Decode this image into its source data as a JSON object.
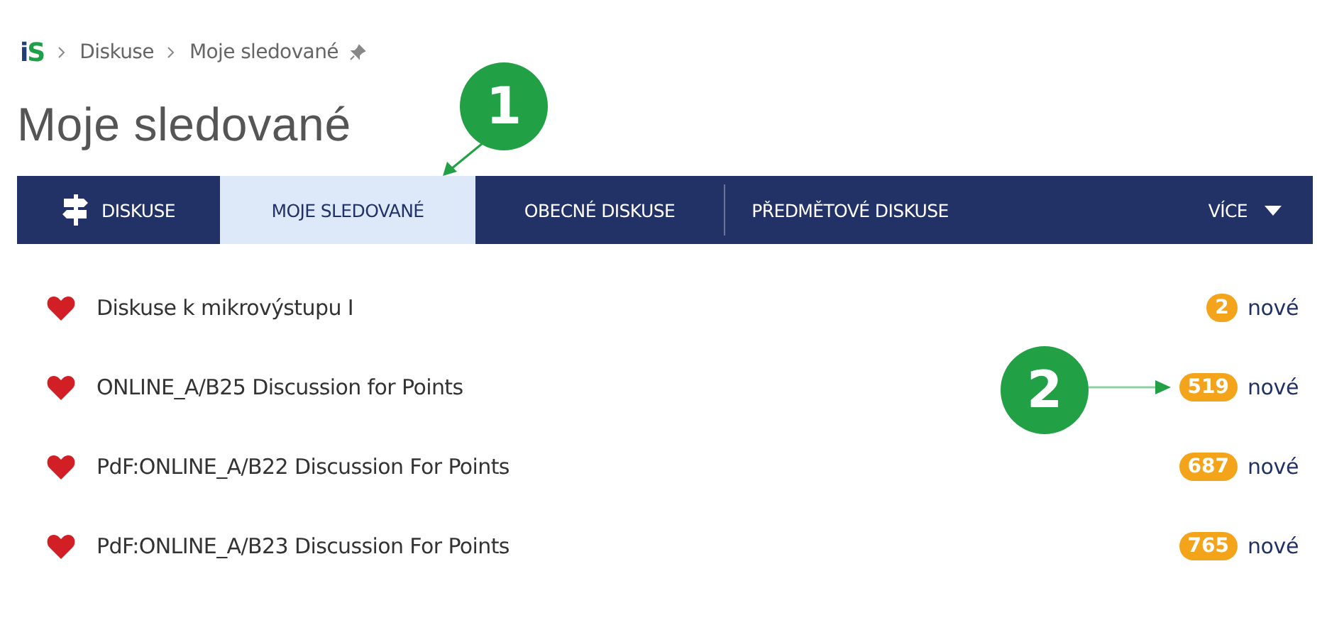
{
  "logo": [
    "i",
    "S"
  ],
  "breadcrumb": [
    "Diskuse",
    "Moje sledované"
  ],
  "title": "Moje sledované",
  "tabs": [
    {
      "label": "DISKUSE",
      "selected": false,
      "kind": "icon"
    },
    {
      "label": "MOJE SLEDOVANÉ",
      "selected": true,
      "kind": "plain"
    },
    {
      "label": "OBECNÉ DISKUSE",
      "selected": false,
      "kind": "plain"
    },
    {
      "label": "PŘEDMĚTOVÉ DISKUSE",
      "selected": false,
      "kind": "plain"
    }
  ],
  "more_menu": "VÍCE",
  "discussions": [
    {
      "name": "Diskuse k mikrovýstupu I",
      "count": "2",
      "new_label": "nové"
    },
    {
      "name": "ONLINE_A/B25 Discussion for Points",
      "count": "519",
      "new_label": "nové"
    },
    {
      "name": "PdF:ONLINE_A/B22 Discussion For Points",
      "count": "687",
      "new_label": "nové"
    },
    {
      "name": "PdF:ONLINE_A/B23 Discussion For Points",
      "count": "765",
      "new_label": "nové"
    }
  ],
  "callouts": [
    "1",
    "2"
  ]
}
